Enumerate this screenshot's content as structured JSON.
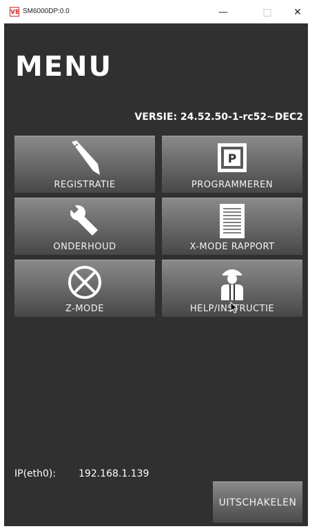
{
  "window": {
    "app_icon_text": "VE",
    "title": "SM6000DP:0.0",
    "minimize_glyph": "—",
    "maximize_glyph": "□",
    "close_glyph": "✕"
  },
  "menu": {
    "title": "MENU",
    "version": "VERSIE: 24.52.50-1-rc52~DEC2",
    "buttons": [
      {
        "label": "REGISTRATIE",
        "icon": "pen-icon"
      },
      {
        "label": "PROGRAMMEREN",
        "icon": "p-key-icon",
        "icon_text": "P"
      },
      {
        "label": "ONDERHOUD",
        "icon": "wrench-icon"
      },
      {
        "label": "X-MODE RAPPORT",
        "icon": "report-icon"
      },
      {
        "label": "Z-MODE",
        "icon": "circle-x-icon"
      },
      {
        "label": "HELP/INSTRUCTIE",
        "icon": "person-icon"
      }
    ]
  },
  "footer": {
    "ip_label": "IP(eth0):",
    "ip_value": "192.168.1.139",
    "shutdown_label": "UITSCHAKELEN"
  },
  "colors": {
    "background": "#303030",
    "button_top": "#8a8a8a",
    "button_bottom": "#474747",
    "text": "#ffffff"
  }
}
